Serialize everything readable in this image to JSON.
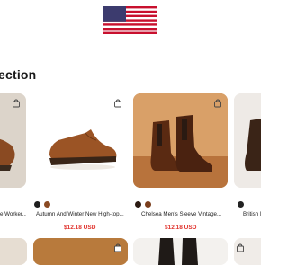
{
  "header": {
    "flag_icon": "us-flag-icon"
  },
  "section": {
    "title": "ection"
  },
  "colors": {
    "price": "#e0312b",
    "brown": "#8a4a22",
    "wood": "#c98a52"
  },
  "products": [
    {
      "name": "e Worker...",
      "price": ""
    },
    {
      "name": "Autumn And Winter New High-top...",
      "price": "$12.18 USD"
    },
    {
      "name": "Chelsea Men's Sleeve Vintage...",
      "price": "$12.18 USD"
    },
    {
      "name": "British M",
      "price": ""
    }
  ]
}
